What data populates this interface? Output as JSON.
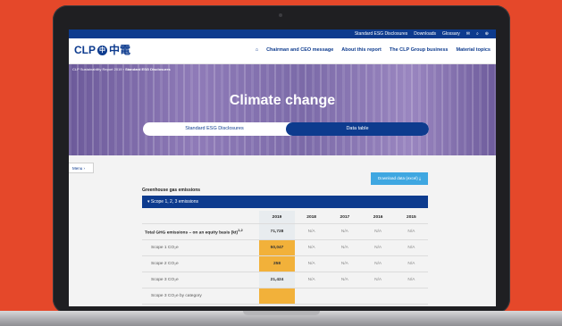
{
  "utility_bar": {
    "links": [
      "Standard ESG Disclosures",
      "Downloads",
      "Glossary"
    ],
    "icons": [
      "mail-icon",
      "search-icon",
      "globe-icon"
    ]
  },
  "nav": {
    "logo_text": "CLP",
    "logo_cn": "中電",
    "logo_mark": "中",
    "links": [
      "Chairman and CEO message",
      "About this report",
      "The CLP Group business",
      "Material topics"
    ]
  },
  "hero": {
    "breadcrumb_root": "CLP Sustainability Report 2019",
    "breadcrumb_current": "Standard ESG Disclosures",
    "title": "Climate change",
    "tabs": [
      "Standard ESG Disclosures",
      "Data table"
    ],
    "active_tab": 1
  },
  "content": {
    "menu_label": "Menu",
    "download_label": "Download data (excel)",
    "section_title": "Greenhouse gas emissions",
    "scope_bar": "Scope 1, 2, 3 emissions",
    "table": {
      "years": [
        "2019",
        "2018",
        "2017",
        "2016",
        "2015"
      ],
      "rows": [
        {
          "label": "Total GHG emissions – on an equity basis (kt)",
          "superscript": "1,2",
          "values": [
            "71,728",
            "N/A",
            "N/A",
            "N/A",
            "N/A"
          ]
        },
        {
          "label": "Scope 1 CO₂e",
          "values": [
            "50,047",
            "N/A",
            "N/A",
            "N/A",
            "N/A"
          ]
        },
        {
          "label": "Scope 2 CO₂e",
          "values": [
            "258",
            "N/A",
            "N/A",
            "N/A",
            "N/A"
          ]
        },
        {
          "label": "Scope 3 CO₂e",
          "values": [
            "21,424",
            "N/A",
            "N/A",
            "N/A",
            "N/A"
          ]
        },
        {
          "label": "Scope 3 CO₂e by category",
          "values": [
            "",
            "",
            "",
            "",
            ""
          ]
        }
      ]
    }
  },
  "colors": {
    "background": "#e5482a",
    "brand_blue": "#0d3b8e",
    "highlight_orange": "#f2b13a",
    "download_button": "#3fa7e1"
  }
}
